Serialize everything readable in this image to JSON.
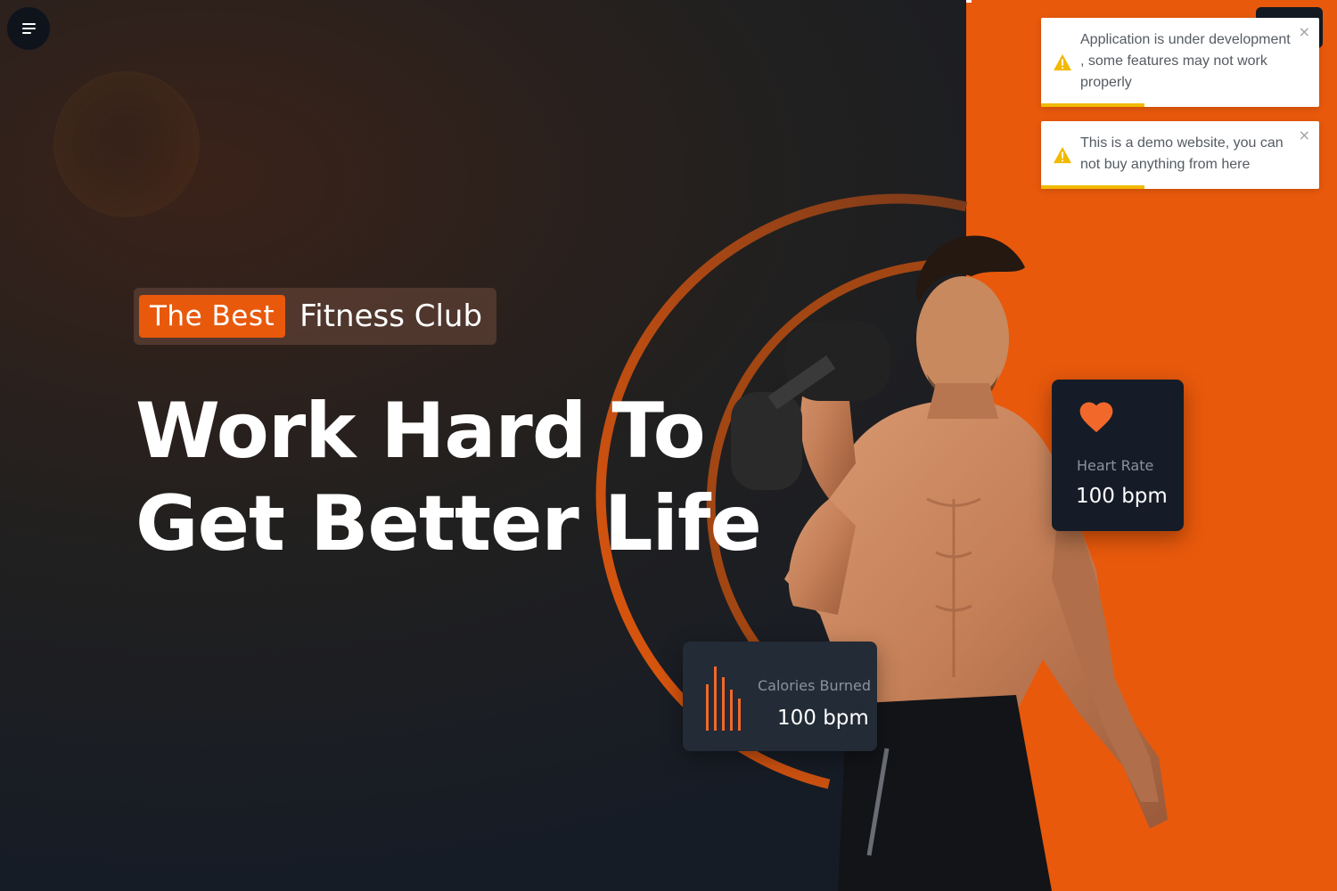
{
  "theme": {
    "accent": "#e8590c",
    "background": "#141a24",
    "card": "#151c27",
    "toast_warning": "#f1b900"
  },
  "nav": {
    "menu_icon": "hamburger-menu-icon"
  },
  "hero": {
    "badge_highlight": "The Best",
    "badge_text": "Fitness Club",
    "headline_line1": "Work Hard To",
    "headline_line2": "Get Better Life"
  },
  "stats": {
    "heart": {
      "icon": "heart-icon",
      "label": "Heart Rate",
      "value": "100 bpm"
    },
    "calories": {
      "icon": "bar-chart-icon",
      "label": "Calories Burned",
      "value": "100 bpm"
    }
  },
  "toasts": [
    {
      "icon": "warning-icon",
      "message": "Application is under development , some features may not work properly",
      "close": "×",
      "progress": 0.37
    },
    {
      "icon": "warning-icon",
      "message": "This is a demo website, you can not buy anything from here",
      "close": "×",
      "progress": 0.37
    }
  ]
}
